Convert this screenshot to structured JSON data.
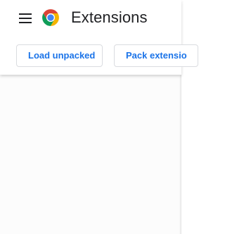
{
  "header": {
    "title": "Extensions",
    "menu_icon": "hamburger-menu-icon",
    "logo_icon": "chrome-logo-icon"
  },
  "toolbar": {
    "load_unpacked_label": "Load unpacked",
    "pack_extension_label": "Pack extensio"
  },
  "colors": {
    "accent": "#1a73e8",
    "title_text": "#202124",
    "button_border": "#dadce0",
    "content_bg": "#fcfcfc"
  }
}
